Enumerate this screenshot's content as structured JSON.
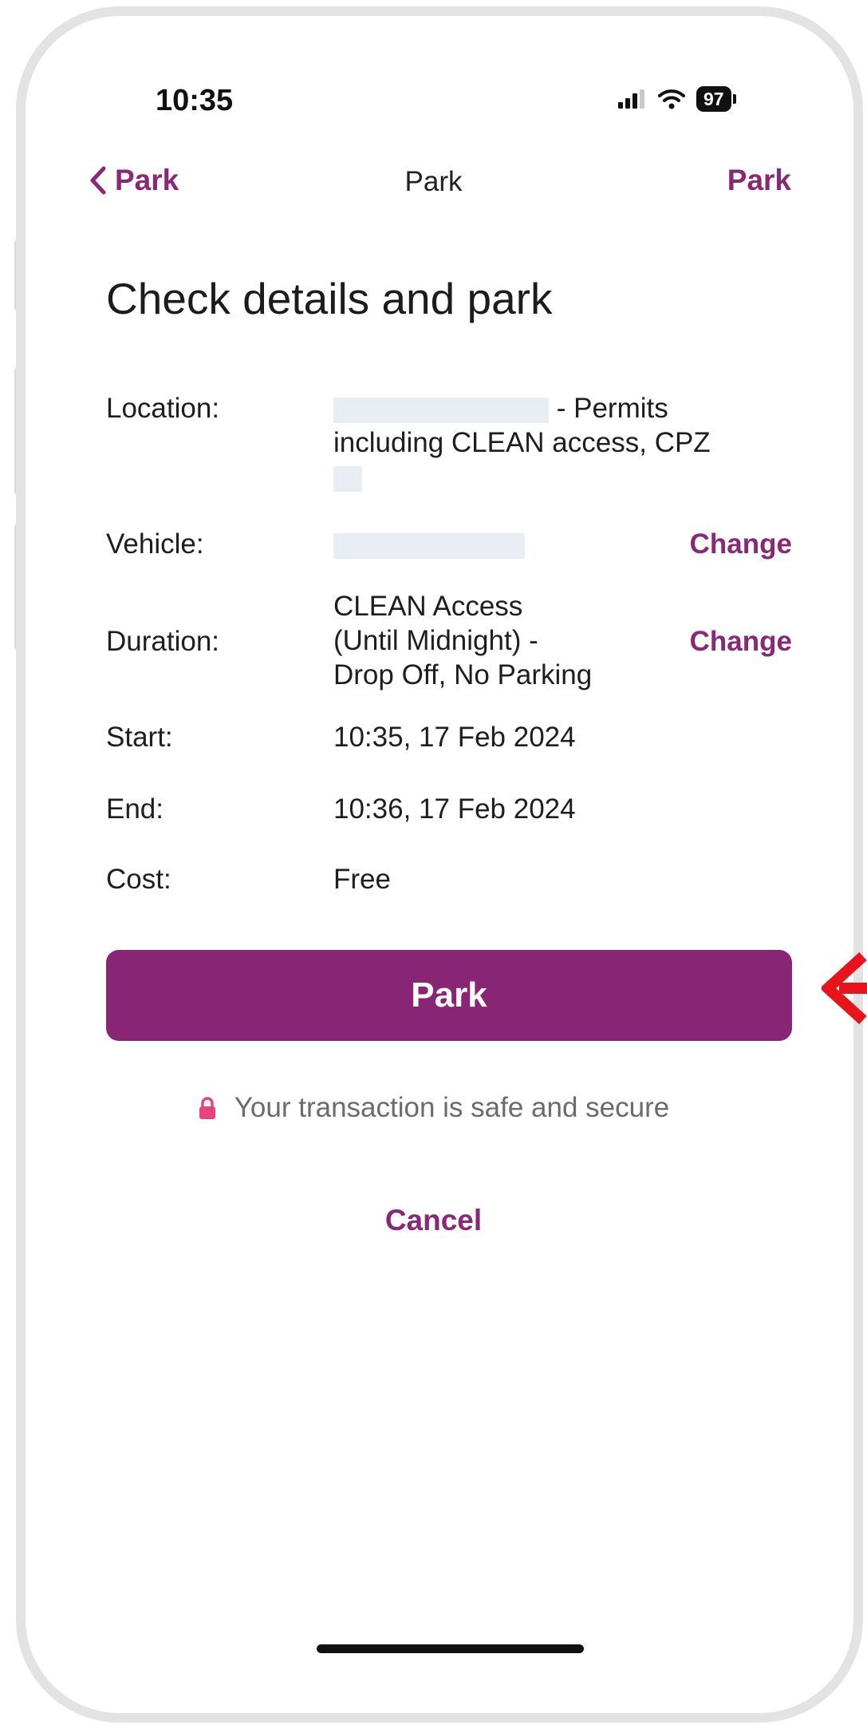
{
  "status_bar": {
    "time": "10:35",
    "battery": "97"
  },
  "nav": {
    "back_label": "Park",
    "title": "Park",
    "right_label": "Park"
  },
  "page": {
    "heading": "Check details and park"
  },
  "details": {
    "location": {
      "label": "Location:",
      "value_line1_suffix": "- Permits",
      "value_line2": "including CLEAN access, CPZ"
    },
    "vehicle": {
      "label": "Vehicle:",
      "change": "Change"
    },
    "duration": {
      "label": "Duration:",
      "value_lines": [
        "CLEAN Access",
        "(Until Midnight) -",
        "Drop Off, No Parking"
      ],
      "change": "Change"
    },
    "start": {
      "label": "Start:",
      "value": "10:35, 17 Feb 2024"
    },
    "end": {
      "label": "End:",
      "value": "10:36, 17 Feb 2024"
    },
    "cost": {
      "label": "Cost:",
      "value": "Free"
    }
  },
  "actions": {
    "park_button": "Park",
    "secure_text": "Your transaction is safe and secure",
    "cancel": "Cancel"
  },
  "colors": {
    "accent": "#882575",
    "lock": "#e5457f",
    "arrow": "#e8141b"
  }
}
